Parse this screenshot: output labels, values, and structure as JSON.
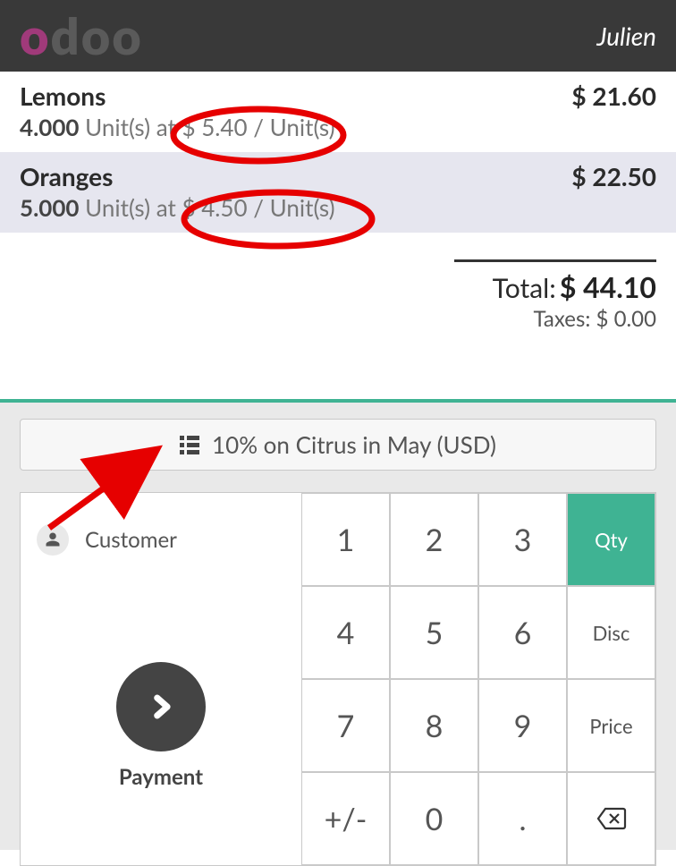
{
  "header": {
    "brand": "odoo",
    "username": "Julien"
  },
  "order": {
    "lines": [
      {
        "product": "Lemons",
        "qty": "4.000",
        "uom": "Unit(s)",
        "price_unit": "$ 5.40",
        "per_uom": "Unit(s)",
        "subtotal": "$ 21.60",
        "selected": false
      },
      {
        "product": "Oranges",
        "qty": "5.000",
        "uom": "Unit(s)",
        "price_unit": "$ 4.50",
        "per_uom": "Unit(s)",
        "subtotal": "$ 22.50",
        "selected": true
      }
    ],
    "total_label": "Total:",
    "total_value": "$ 44.10",
    "taxes_label": "Taxes:",
    "taxes_value": "$ 0.00"
  },
  "pricelist": {
    "label": "10% on Citrus in May (USD)"
  },
  "pad": {
    "customer_label": "Customer",
    "payment_label": "Payment",
    "keys": {
      "k1": "1",
      "k2": "2",
      "k3": "3",
      "k4": "4",
      "k5": "5",
      "k6": "6",
      "k7": "7",
      "k8": "8",
      "k9": "9",
      "k0": "0",
      "plusminus": "+/-",
      "dot": "."
    },
    "modes": {
      "qty": "Qty",
      "disc": "Disc",
      "price": "Price"
    }
  }
}
